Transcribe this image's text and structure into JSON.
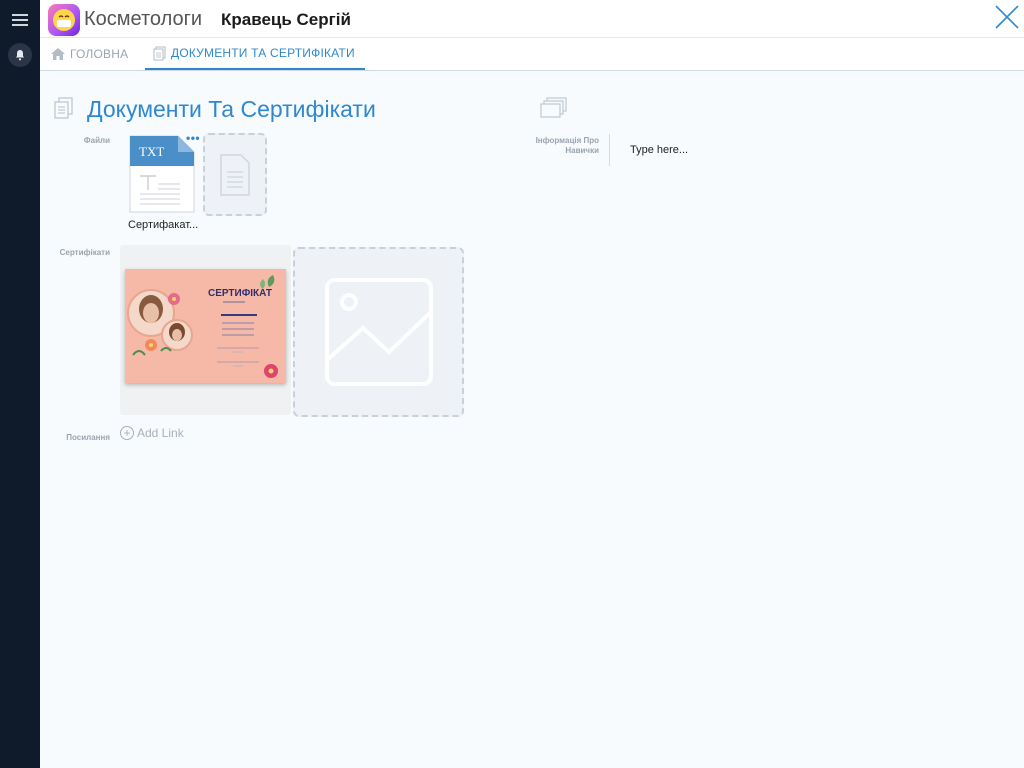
{
  "app": {
    "name": "Косметологи",
    "person": "Кравець Сергій",
    "logo_icon": "face-mask-emoji"
  },
  "tabs": [
    {
      "label": "ГОЛОВНА",
      "icon": "home-icon",
      "active": false
    },
    {
      "label": "ДОКУМЕНТИ ТА СЕРТИФІКАТИ",
      "icon": "document-icon",
      "active": true
    }
  ],
  "section": {
    "title": "Документи Та Сертифікати"
  },
  "fields": {
    "files_label": "Файли",
    "certs_label": "Сертифікати",
    "links_label": "Посилання",
    "skills_label": "Інформація Про Навички"
  },
  "files": [
    {
      "type": "TXT",
      "name": "Сертифакат..."
    }
  ],
  "certificate": {
    "title": "СЕРТИФІКАТ"
  },
  "links": {
    "add_label": "Add Link"
  },
  "skills": {
    "placeholder": "Type here..."
  },
  "colors": {
    "accent": "#2f88cf",
    "rail": "#0f1a2a",
    "certificate_bg": "#f6b9a8"
  }
}
